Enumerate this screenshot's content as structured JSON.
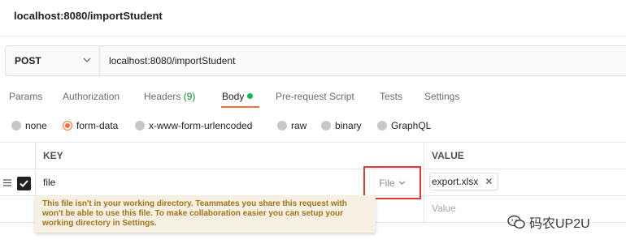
{
  "header": {
    "title": "localhost:8080/importStudent"
  },
  "request": {
    "method": "POST",
    "url": "localhost:8080/importStudent"
  },
  "tabs": {
    "params": "Params",
    "authorization": "Authorization",
    "headers": "Headers",
    "headers_count": "(9)",
    "body": "Body",
    "prerequest": "Pre-request Script",
    "tests": "Tests",
    "settings": "Settings"
  },
  "body_types": {
    "none": "none",
    "form_data": "form-data",
    "urlencoded": "x-www-form-urlencoded",
    "raw": "raw",
    "binary": "binary",
    "graphql": "GraphQL",
    "selected": "form-data"
  },
  "table": {
    "col_key": "KEY",
    "col_value": "VALUE",
    "row": {
      "key": "file",
      "type": "File",
      "value_file": "export.xlsx",
      "checked": true
    },
    "value_placeholder": "Value"
  },
  "tooltip": {
    "text": "This file isn't in your working directory. Teammates you share this request with won't be able to use this file. To make collaboration easier you can setup your working directory in Settings."
  },
  "watermark": {
    "text": "码农UP2U"
  },
  "colors": {
    "accent": "#ff6c37",
    "alert_border": "#e53935",
    "tooltip_text": "#a0731a"
  }
}
